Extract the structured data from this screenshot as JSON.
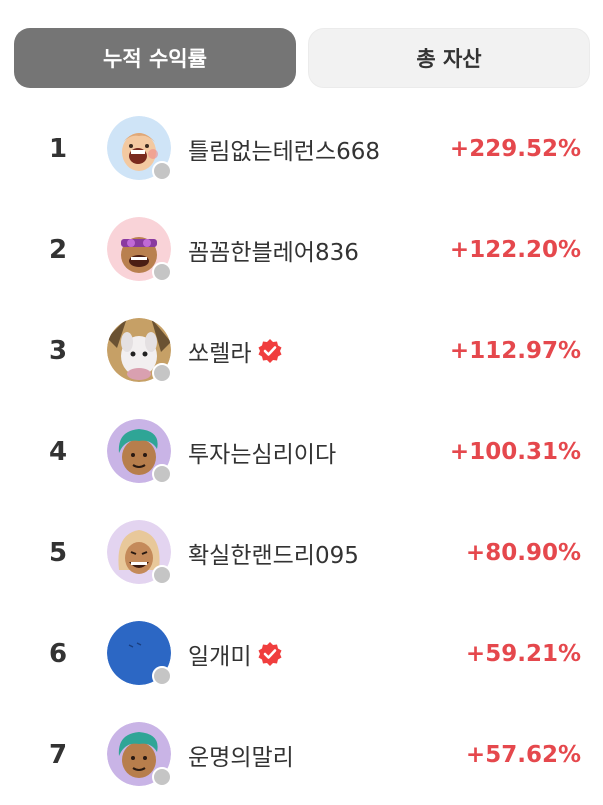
{
  "tabs": {
    "cumulative_return": "누적 수익률",
    "total_assets": "총 자산"
  },
  "colors": {
    "active_tab_bg": "#757575",
    "inactive_tab_bg": "#f2f2f2",
    "positive_value": "#e5484d",
    "verified_badge": "#f03e3e",
    "status_dot": "#c5c5c5"
  },
  "rankings": [
    {
      "rank": "1",
      "name": "틀림없는테런스668",
      "value": "+229.52%",
      "verified": false,
      "avatar": "character-avatar-blue"
    },
    {
      "rank": "2",
      "name": "꼼꼼한블레어836",
      "value": "+122.20%",
      "verified": false,
      "avatar": "character-avatar-pink"
    },
    {
      "rank": "3",
      "name": "쏘렐라",
      "value": "+112.97%",
      "verified": true,
      "avatar": "cat-photo-avatar"
    },
    {
      "rank": "4",
      "name": "투자는심리이다",
      "value": "+100.31%",
      "verified": false,
      "avatar": "character-avatar-purple-green-hair"
    },
    {
      "rank": "5",
      "name": "확실한랜드리095",
      "value": "+80.90%",
      "verified": false,
      "avatar": "character-avatar-blonde"
    },
    {
      "rank": "6",
      "name": "일개미",
      "value": "+59.21%",
      "verified": true,
      "avatar": "blue-circle-avatar"
    },
    {
      "rank": "7",
      "name": "운명의말리",
      "value": "+57.62%",
      "verified": false,
      "avatar": "character-avatar-purple-green-hair"
    }
  ]
}
